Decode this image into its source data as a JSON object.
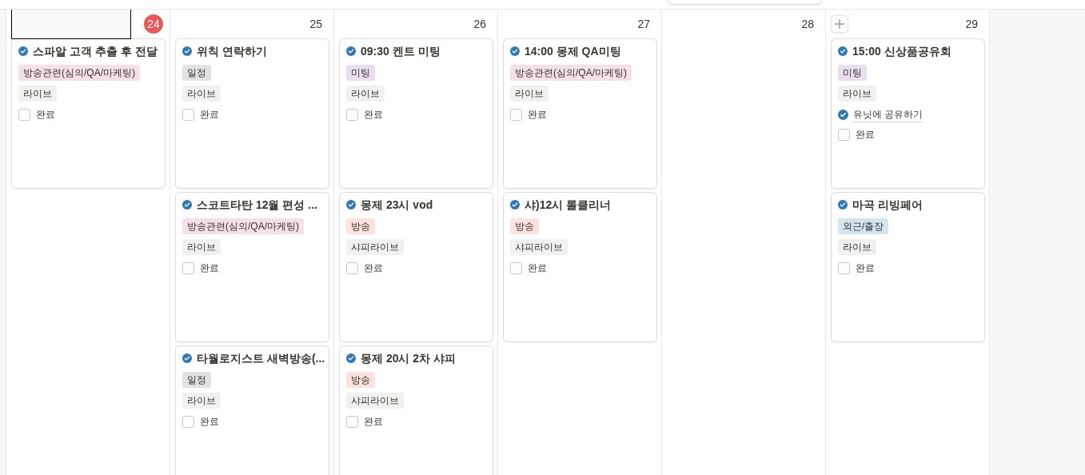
{
  "days": [
    {
      "date": "24",
      "today": true,
      "cards": [
        {
          "title": "스파알 고객 추출 후 전달",
          "tags": [
            {
              "label": "방송관련(심의/QA/마케팅)",
              "color": "#f5e0e9"
            },
            {
              "label": "라이브",
              "color": "#f1f1ef"
            }
          ],
          "done": {
            "label": "완료",
            "checked": false
          }
        }
      ]
    },
    {
      "date": "25",
      "today": false,
      "cards": [
        {
          "title": "위칙 연락하기",
          "tags": [
            {
              "label": "일정",
              "color": "#e3e2e0"
            },
            {
              "label": "라이브",
              "color": "#f1f1ef"
            }
          ],
          "done": {
            "label": "완료",
            "checked": false
          }
        },
        {
          "title": "스코트타탄 12월 편성 ...",
          "tags": [
            {
              "label": "방송관련(심의/QA/마케팅)",
              "color": "#f5e0e9"
            },
            {
              "label": "라이브",
              "color": "#f1f1ef"
            }
          ],
          "done": {
            "label": "완료",
            "checked": false
          }
        },
        {
          "title": "타월로지스트 새벽방송(...",
          "tags": [
            {
              "label": "일정",
              "color": "#e3e2e0"
            },
            {
              "label": "라이브",
              "color": "#f1f1ef"
            }
          ],
          "done": {
            "label": "완료",
            "checked": false
          }
        }
      ]
    },
    {
      "date": "26",
      "today": false,
      "cards": [
        {
          "title": "09:30 켄트 미팅",
          "tags": [
            {
              "label": "미팅",
              "color": "#e8deee"
            },
            {
              "label": "라이브",
              "color": "#f1f1ef"
            }
          ],
          "done": {
            "label": "완료",
            "checked": false
          }
        },
        {
          "title": "몽제 23시 vod",
          "tags": [
            {
              "label": "방송",
              "color": "#ffe2dd"
            },
            {
              "label": "샤피라이브",
              "color": "#f1f1ef"
            }
          ],
          "done": {
            "label": "완료",
            "checked": false
          }
        },
        {
          "title": "몽제 20시 2차 샤피",
          "tags": [
            {
              "label": "방송",
              "color": "#ffe2dd"
            },
            {
              "label": "샤피라이브",
              "color": "#f1f1ef"
            }
          ],
          "done": {
            "label": "완료",
            "checked": false
          }
        }
      ]
    },
    {
      "date": "27",
      "today": false,
      "cards": [
        {
          "title": "14:00 몽제 QA미팅",
          "tags": [
            {
              "label": "방송관련(심의/QA/마케팅)",
              "color": "#f5e0e9"
            },
            {
              "label": "라이브",
              "color": "#f1f1ef"
            }
          ],
          "done": {
            "label": "완료",
            "checked": false
          }
        },
        {
          "title": "샤)12시 롤클리너",
          "tags": [
            {
              "label": "방송",
              "color": "#ffe2dd"
            },
            {
              "label": "샤피라이브",
              "color": "#f1f1ef"
            }
          ],
          "done": {
            "label": "완료",
            "checked": false
          }
        }
      ]
    },
    {
      "date": "28",
      "today": false
    },
    {
      "date": "29",
      "today": false,
      "add_button": true,
      "cards": [
        {
          "title": "15:00 신상품공유회",
          "tags": [
            {
              "label": "미팅",
              "color": "#e8deee"
            },
            {
              "label": "라이브",
              "color": "#f1f1ef"
            }
          ],
          "links": [
            "유닛에 공유하기"
          ],
          "done": {
            "label": "완료",
            "checked": false
          }
        },
        {
          "title": "마곡 리빙페어",
          "tags": [
            {
              "label": "외근/출장",
              "color": "#d3e5ef"
            },
            {
              "label": "라이브",
              "color": "#f1f1ef"
            }
          ],
          "done": {
            "label": "완료",
            "checked": false
          }
        }
      ]
    }
  ]
}
